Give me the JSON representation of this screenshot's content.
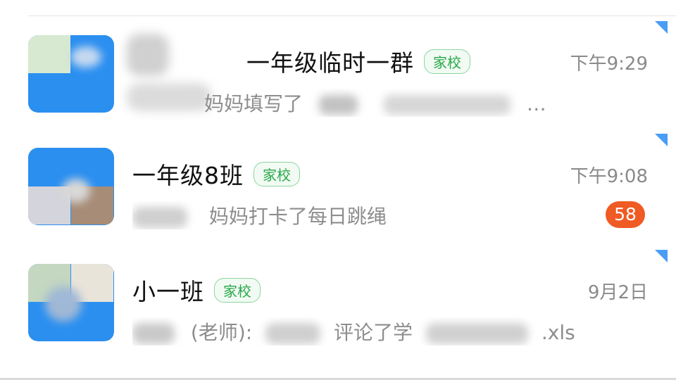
{
  "chats": [
    {
      "title": "一年级临时一群",
      "tag": "家校",
      "time": "下午9:29",
      "preview": "妈妈填写了",
      "preview_suffix": "…"
    },
    {
      "title": "一年级8班",
      "tag": "家校",
      "time": "下午9:08",
      "preview": "妈妈打卡了每日跳绳",
      "unread": "58"
    },
    {
      "title": "小一班",
      "tag": "家校",
      "time": "9月2日",
      "preview_prefix": "(老师):",
      "preview_middle": "评论了学",
      "preview_end": ".xls"
    }
  ],
  "colors": {
    "accent": "#2b8ff0",
    "tag_green": "#2aa84a",
    "unread_badge": "#f05a24",
    "pin_corner": "#4a9df5"
  },
  "icons": {
    "pin": "corner-triangle-icon"
  }
}
